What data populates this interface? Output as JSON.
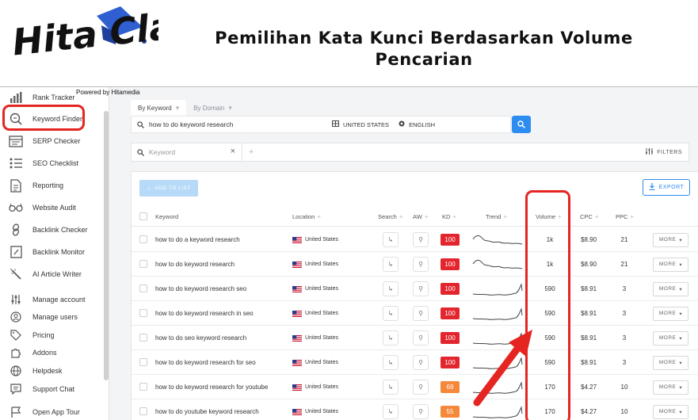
{
  "banner": {
    "headline_line1": "Pemilihan Kata Kunci Berdasarkan Volume",
    "headline_line2": "Pencarian",
    "powered_by": "Powered by Hitamedia",
    "logo_text": "Hita Class"
  },
  "colors": {
    "accent": "#2d8cf0",
    "highlight": "#e52521",
    "kd_red": "#e3262e",
    "kd_orange": "#f5883b"
  },
  "sidebar": {
    "items": [
      {
        "label": "Rank Tracker",
        "icon": "bar-chart-icon"
      },
      {
        "label": "Keyword Finder",
        "icon": "keyword-search-icon"
      },
      {
        "label": "SERP Checker",
        "icon": "serp-window-icon"
      },
      {
        "label": "SEO Checklist",
        "icon": "checklist-icon"
      },
      {
        "label": "Reporting",
        "icon": "document-icon"
      },
      {
        "label": "Website Audit",
        "icon": "glasses-icon"
      },
      {
        "label": "Backlink Checker",
        "icon": "link-icon"
      },
      {
        "label": "Backlink Monitor",
        "icon": "monitor-link-icon"
      },
      {
        "label": "AI Article Writer",
        "icon": "magic-wand-icon"
      },
      {
        "label": "Manage account",
        "icon": "sliders-icon"
      },
      {
        "label": "Manage users",
        "icon": "user-circle-icon"
      },
      {
        "label": "Pricing",
        "icon": "price-tag-icon"
      },
      {
        "label": "Addons",
        "icon": "puzzle-icon"
      },
      {
        "label": "Helpdesk",
        "icon": "globe-icon"
      },
      {
        "label": "Support Chat",
        "icon": "chat-icon"
      },
      {
        "label": "Open App Tour",
        "icon": "flag-icon"
      }
    ]
  },
  "tabs": [
    {
      "label": "By Keyword"
    },
    {
      "label": "By Domain"
    }
  ],
  "search": {
    "query": "how to do keyword research",
    "country": "UNITED STATES",
    "language": "ENGLISH"
  },
  "filter": {
    "placeholder": "Keyword",
    "filters_label": "FILTERS"
  },
  "toolbar": {
    "add_label": "ADD TO LIST",
    "export_label": "EXPORT"
  },
  "table": {
    "headers": {
      "keyword": "Keyword",
      "location": "Location",
      "search": "Search",
      "aw": "AW",
      "kd": "KD",
      "trend": "Trend",
      "volume": "Volume",
      "cpc": "CPC",
      "ppc": "PPC"
    },
    "more_label": "MORE",
    "rows": [
      {
        "keyword": "how to do a keyword research",
        "location": "United States",
        "kd": "100",
        "kd_color": "#e3262e",
        "volume": "1k",
        "cpc": "$8.90",
        "ppc": "21",
        "trend": "wave"
      },
      {
        "keyword": "how to do keyword research",
        "location": "United States",
        "kd": "100",
        "kd_color": "#e3262e",
        "volume": "1k",
        "cpc": "$8.90",
        "ppc": "21",
        "trend": "wave"
      },
      {
        "keyword": "how to do keyword research seo",
        "location": "United States",
        "kd": "100",
        "kd_color": "#e3262e",
        "volume": "590",
        "cpc": "$8.91",
        "ppc": "3",
        "trend": "spike"
      },
      {
        "keyword": "how to do keyword research in seo",
        "location": "United States",
        "kd": "100",
        "kd_color": "#e3262e",
        "volume": "590",
        "cpc": "$8.91",
        "ppc": "3",
        "trend": "spike"
      },
      {
        "keyword": "how to do seo keyword research",
        "location": "United States",
        "kd": "100",
        "kd_color": "#e3262e",
        "volume": "590",
        "cpc": "$8.91",
        "ppc": "3",
        "trend": "spike"
      },
      {
        "keyword": "how to do keyword research for seo",
        "location": "United States",
        "kd": "100",
        "kd_color": "#e3262e",
        "volume": "590",
        "cpc": "$8.91",
        "ppc": "3",
        "trend": "spike"
      },
      {
        "keyword": "how to do keyword research for youtube",
        "location": "United States",
        "kd": "69",
        "kd_color": "#f5883b",
        "volume": "170",
        "cpc": "$4.27",
        "ppc": "10",
        "trend": "spike"
      },
      {
        "keyword": "how to do youtube keyword research",
        "location": "United States",
        "kd": "55",
        "kd_color": "#f5883b",
        "volume": "170",
        "cpc": "$4.27",
        "ppc": "10",
        "trend": "spike"
      }
    ]
  }
}
